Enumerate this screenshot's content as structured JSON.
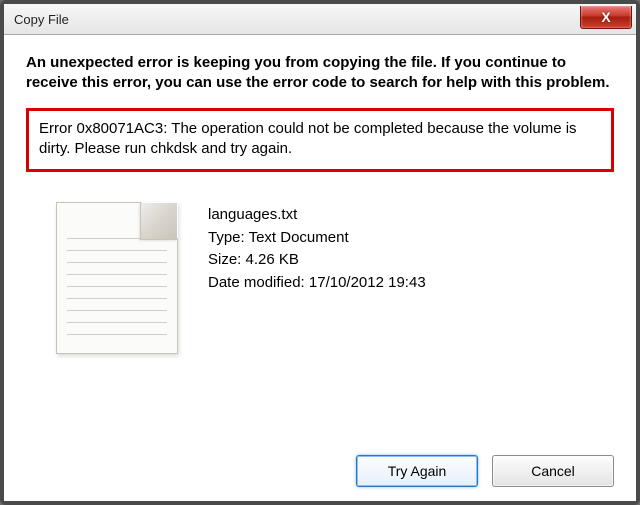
{
  "window": {
    "title": "Copy File"
  },
  "message": {
    "intro": "An unexpected error is keeping you from copying the file. If you continue to receive this error, you can use the error code to search for help with this problem.",
    "error": "Error 0x80071AC3: The operation could not be completed because the volume is dirty. Please run chkdsk and try again."
  },
  "file": {
    "name": "languages.txt",
    "type_line": "Type: Text Document",
    "size_line": "Size: 4.26 KB",
    "modified_line": "Date modified: 17/10/2012 19:43"
  },
  "buttons": {
    "try_again": "Try Again",
    "cancel": "Cancel"
  },
  "close_glyph": "X"
}
